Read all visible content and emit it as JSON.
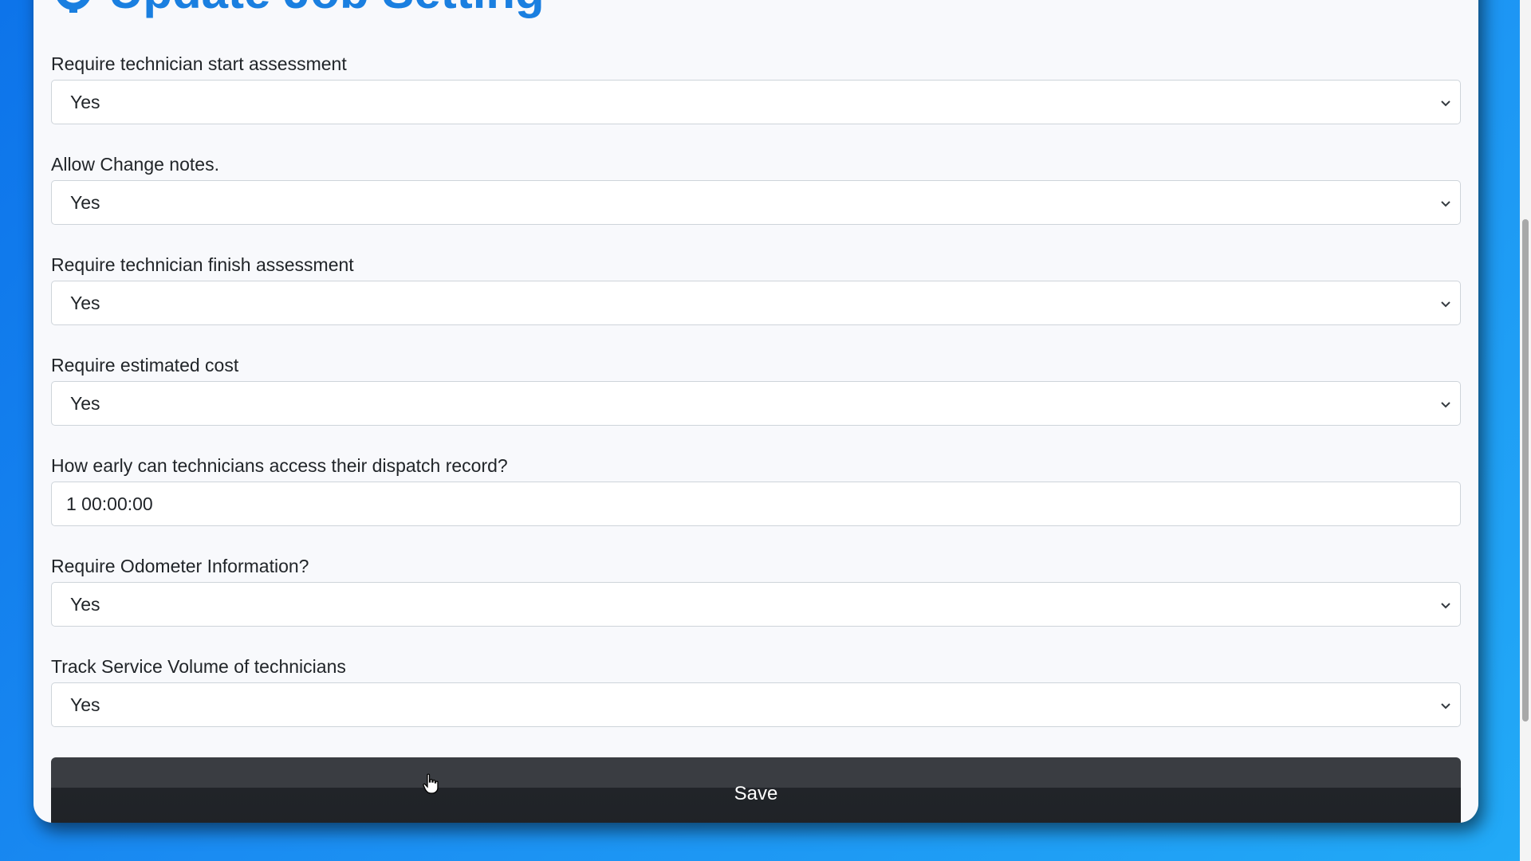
{
  "header": {
    "title": "Update Job Setting",
    "icon": "gear-icon",
    "color": "#1a7fe0"
  },
  "form": {
    "fields": [
      {
        "label": "Require technician start assessment",
        "type": "select",
        "value": "Yes"
      },
      {
        "label": "Allow Change notes.",
        "type": "select",
        "value": "Yes"
      },
      {
        "label": "Require technician finish assessment",
        "type": "select",
        "value": "Yes"
      },
      {
        "label": "Require estimated cost",
        "type": "select",
        "value": "Yes"
      },
      {
        "label": "How early can technicians access their dispatch record?",
        "type": "text",
        "value": "1 00:00:00"
      },
      {
        "label": "Require Odometer Information?",
        "type": "select",
        "value": "Yes"
      },
      {
        "label": "Track Service Volume of technicians",
        "type": "select",
        "value": "Yes"
      }
    ],
    "save_label": "Save"
  },
  "colors": {
    "background": "#1a8cf2",
    "card": "#f8f9fc",
    "button": "#212429"
  }
}
